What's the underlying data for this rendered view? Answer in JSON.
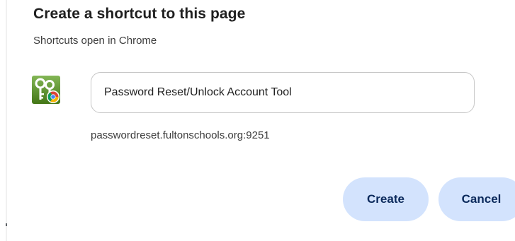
{
  "dialog": {
    "title": "Create a shortcut to this page",
    "subtitle": "Shortcuts open in Chrome"
  },
  "shortcut": {
    "icon": "keys-app-icon-with-chrome-badge",
    "name_value": "Password Reset/Unlock Account Tool",
    "url": "passwordreset.fultonschools.org:9251"
  },
  "buttons": {
    "create_label": "Create",
    "cancel_label": "Cancel"
  },
  "colors": {
    "button_bg": "#d3e3fd",
    "button_text": "#0b2a5c",
    "icon_green": "#5a9e1e",
    "input_border": "#c7c7c7"
  }
}
